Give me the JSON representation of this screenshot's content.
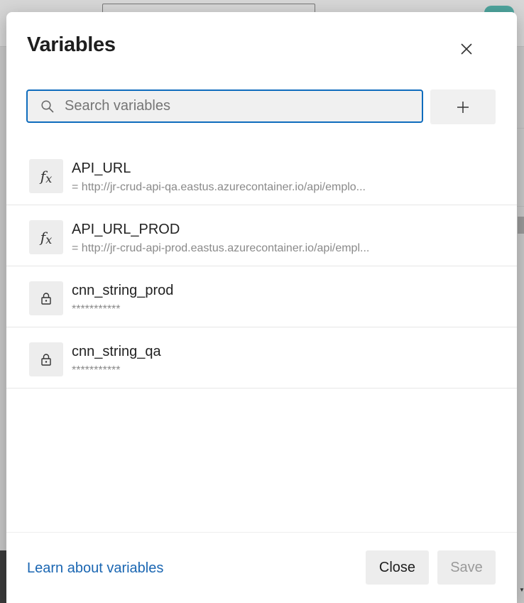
{
  "dialog": {
    "title": "Variables",
    "close_icon": "close-icon"
  },
  "search": {
    "placeholder": "Search variables",
    "value": "",
    "icon": "search-icon"
  },
  "add_button": {
    "icon": "plus-icon"
  },
  "variables": [
    {
      "name": "API_URL",
      "value": "= http://jr-crud-api-qa.eastus.azurecontainer.io/api/emplo...",
      "icon": "function-icon",
      "secret": false
    },
    {
      "name": "API_URL_PROD",
      "value": "= http://jr-crud-api-prod.eastus.azurecontainer.io/api/empl...",
      "icon": "function-icon",
      "secret": false
    },
    {
      "name": "cnn_string_prod",
      "value": "***********",
      "icon": "lock-icon",
      "secret": true
    },
    {
      "name": "cnn_string_qa",
      "value": "***********",
      "icon": "lock-icon",
      "secret": true
    }
  ],
  "footer": {
    "learn_link": "Learn about variables",
    "close_label": "Close",
    "save_label": "Save"
  },
  "colors": {
    "accent": "#0f6cbd",
    "link": "#1a66b2",
    "disabled_text": "#9a9a9a"
  }
}
